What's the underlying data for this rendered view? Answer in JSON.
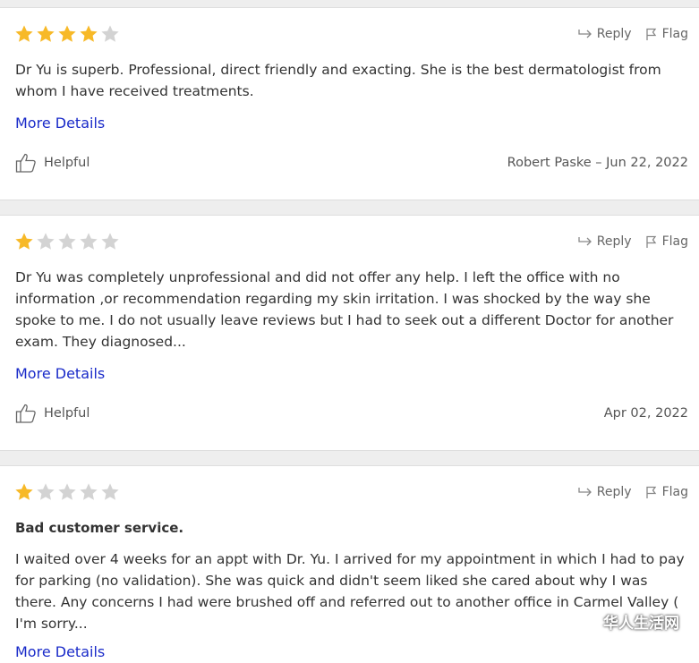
{
  "reviews": [
    {
      "rating": 4,
      "reply_label": "Reply",
      "flag_label": "Flag",
      "text": "Dr Yu is superb. Professional, direct friendly and exacting. She is the best dermatologist from whom I have received treatments.",
      "more_label": "More Details",
      "helpful_label": "Helpful",
      "meta": "Robert Paske – Jun 22, 2022"
    },
    {
      "rating": 1,
      "reply_label": "Reply",
      "flag_label": "Flag",
      "text": "Dr Yu was completely unprofessional and did not offer any help. I left the office with no information ,or recommendation regarding my skin irritation. I was shocked by the way she spoke to me. I do not usually leave reviews but I had to seek out a different Doctor for another exam. They diagnosed...",
      "more_label": "More Details",
      "helpful_label": "Helpful",
      "meta": "Apr 02, 2022"
    },
    {
      "rating": 1,
      "reply_label": "Reply",
      "flag_label": "Flag",
      "headline": "Bad customer service.",
      "text": "I waited over 4 weeks for an appt with Dr. Yu. I arrived for my appointment in which I had to pay for parking (no validation). She was quick and didn't seem liked she cared about why I was there. Any concerns I had were brushed off and referred out to another office in Carmel Valley ( I'm sorry...",
      "more_label": "More Details"
    }
  ],
  "watermark": "华人生活网",
  "colors": {
    "star_on": "#f7b928",
    "star_off": "#d3d3d3",
    "link": "#1a2bc9"
  }
}
